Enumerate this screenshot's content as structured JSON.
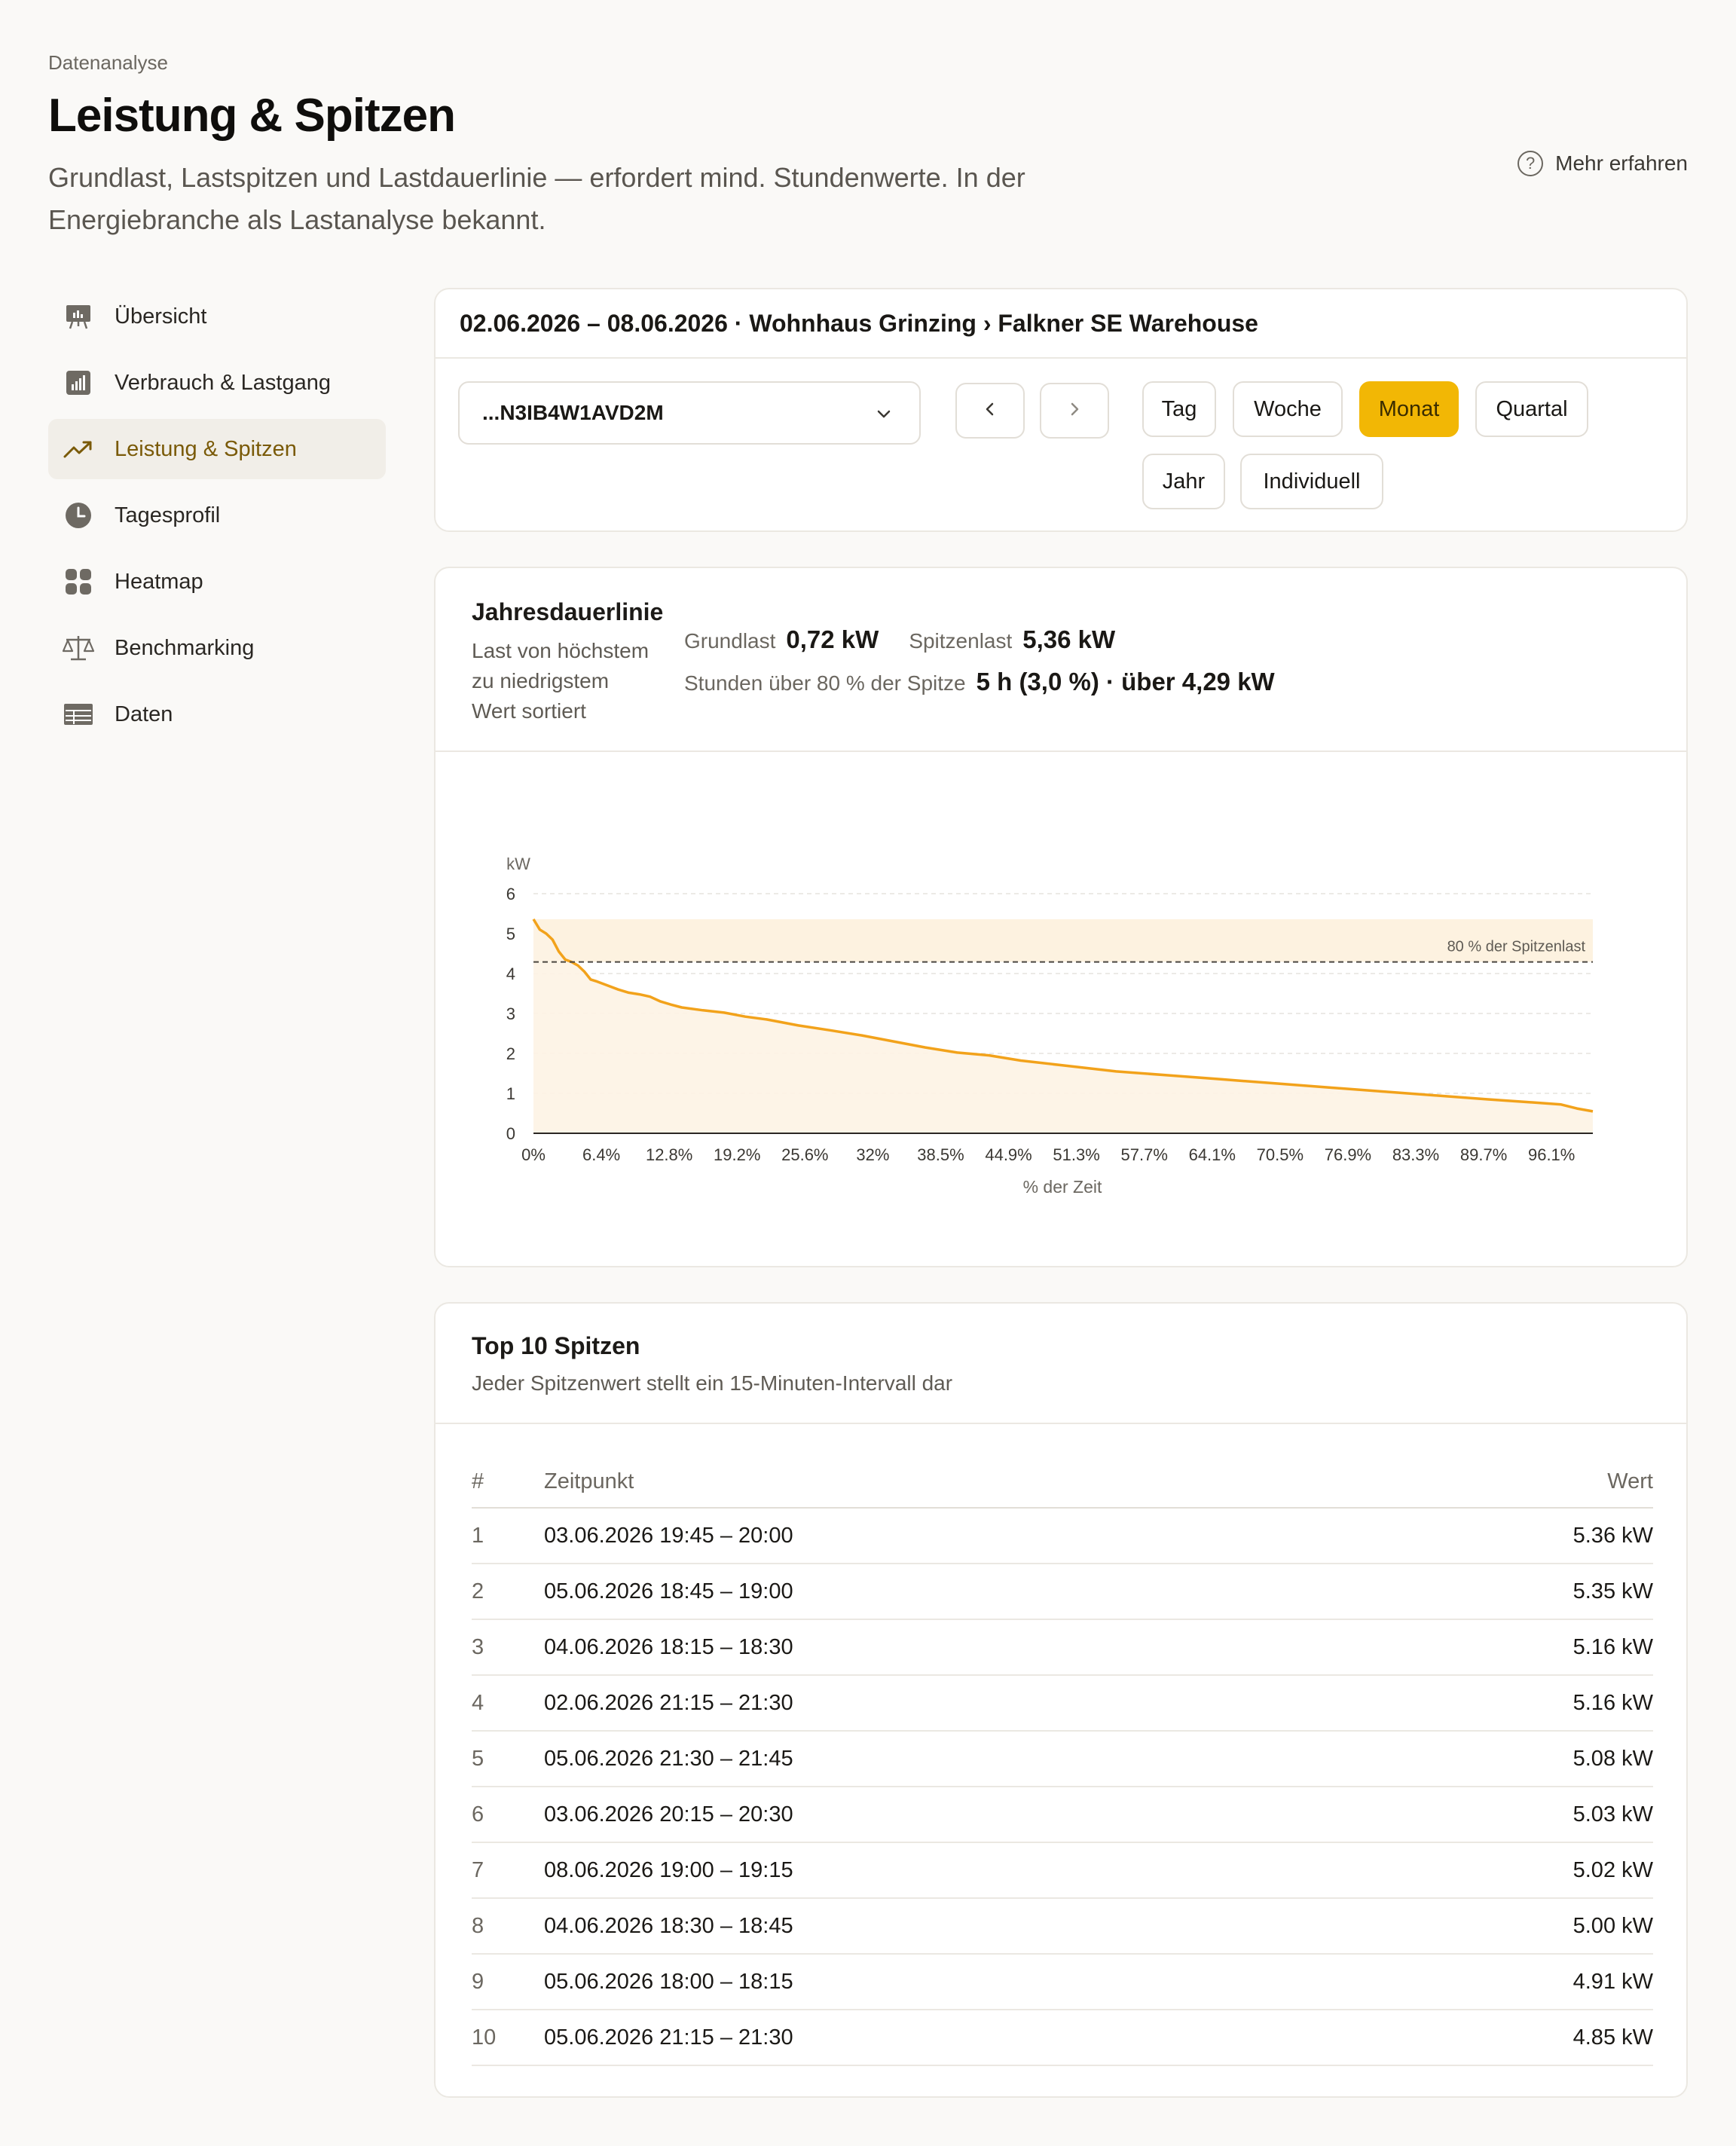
{
  "header": {
    "eyebrow": "Datenanalyse",
    "title": "Leistung & Spitzen",
    "description": "Grundlast, Lastspitzen und Lastdauerlinie — erfordert mind. Stundenwerte. In der Energiebranche als Lastanalyse bekannt.",
    "learn_more": "Mehr erfahren"
  },
  "sidebar": {
    "items": [
      {
        "label": "Übersicht",
        "icon": "presentation-board-icon"
      },
      {
        "label": "Verbrauch & Lastgang",
        "icon": "bar-chart-icon"
      },
      {
        "label": "Leistung & Spitzen",
        "icon": "trending-up-icon"
      },
      {
        "label": "Tagesprofil",
        "icon": "clock-icon"
      },
      {
        "label": "Heatmap",
        "icon": "grid-icon"
      },
      {
        "label": "Benchmarking",
        "icon": "scale-icon"
      },
      {
        "label": "Daten",
        "icon": "table-icon"
      }
    ]
  },
  "filter": {
    "title": "02.06.2026 – 08.06.2026 · Wohnhaus Grinzing › Falkner SE Warehouse",
    "meter_value": "...N3IB4W1AVD2M",
    "periods": [
      "Tag",
      "Woche",
      "Monat",
      "Quartal",
      "Jahr",
      "Individuell"
    ],
    "active_period": "Monat"
  },
  "duration_card": {
    "title": "Jahresdauerlinie",
    "subtitle": "Last von höchstem zu niedrigstem Wert sortiert",
    "base_label": "Grundlast",
    "base_value": "0,72 kW",
    "peak_label": "Spitzenlast",
    "peak_value": "5,36 kW",
    "hours_label": "Stunden über 80 % der Spitze",
    "hours_value": "5 h (3,0 %) · über 4,29 kW"
  },
  "chart_data": {
    "type": "area",
    "ylabel": "kW",
    "xlabel": "% der Zeit",
    "ylim": [
      0,
      6
    ],
    "yticks": [
      0,
      1,
      2,
      3,
      4,
      5,
      6
    ],
    "xticks": [
      "0%",
      "6.4%",
      "12.8%",
      "19.2%",
      "25.6%",
      "32%",
      "38.5%",
      "44.9%",
      "51.3%",
      "57.7%",
      "64.1%",
      "70.5%",
      "76.9%",
      "83.3%",
      "89.7%",
      "96.1%"
    ],
    "threshold_label": "80 % der Spitzenlast",
    "threshold_value": 4.29,
    "band_range": [
      4.29,
      5.36
    ],
    "series": [
      {
        "color": "#f2a21b",
        "x": [
          0,
          0.6,
          1.2,
          1.8,
          2.4,
          3.0,
          3.6,
          4.2,
          4.8,
          5.4,
          6.0,
          7.0,
          8.0,
          9.0,
          10.0,
          11.0,
          12.0,
          13.0,
          14.0,
          16.0,
          18.0,
          20.0,
          22.0,
          25.0,
          28.0,
          31.0,
          34.0,
          37.0,
          40.0,
          43.0,
          46.0,
          50.0,
          55.0,
          60.0,
          65.0,
          70.0,
          75.0,
          80.0,
          85.0,
          90.0,
          94.0,
          97.0,
          98.5,
          100.0
        ],
        "y": [
          5.36,
          5.1,
          5.0,
          4.85,
          4.55,
          4.35,
          4.29,
          4.2,
          4.05,
          3.85,
          3.8,
          3.7,
          3.6,
          3.52,
          3.48,
          3.42,
          3.3,
          3.22,
          3.15,
          3.08,
          3.02,
          2.92,
          2.85,
          2.7,
          2.58,
          2.45,
          2.3,
          2.15,
          2.02,
          1.95,
          1.82,
          1.7,
          1.55,
          1.45,
          1.35,
          1.25,
          1.15,
          1.05,
          0.95,
          0.85,
          0.78,
          0.72,
          0.62,
          0.55
        ]
      }
    ]
  },
  "peaks_card": {
    "title": "Top 10 Spitzen",
    "subtitle": "Jeder Spitzenwert stellt ein 15-Minuten-Intervall dar",
    "columns": [
      "#",
      "Zeitpunkt",
      "Wert"
    ],
    "rows": [
      [
        "1",
        "03.06.2026 19:45 – 20:00",
        "5.36 kW"
      ],
      [
        "2",
        "05.06.2026 18:45 – 19:00",
        "5.35 kW"
      ],
      [
        "3",
        "04.06.2026 18:15 – 18:30",
        "5.16 kW"
      ],
      [
        "4",
        "02.06.2026 21:15 – 21:30",
        "5.16 kW"
      ],
      [
        "5",
        "05.06.2026 21:30 – 21:45",
        "5.08 kW"
      ],
      [
        "6",
        "03.06.2026 20:15 – 20:30",
        "5.03 kW"
      ],
      [
        "7",
        "08.06.2026 19:00 – 19:15",
        "5.02 kW"
      ],
      [
        "8",
        "04.06.2026 18:30 – 18:45",
        "5.00 kW"
      ],
      [
        "9",
        "05.06.2026 18:00 – 18:15",
        "4.91 kW"
      ],
      [
        "10",
        "05.06.2026 21:15 – 21:30",
        "4.85 kW"
      ]
    ]
  }
}
